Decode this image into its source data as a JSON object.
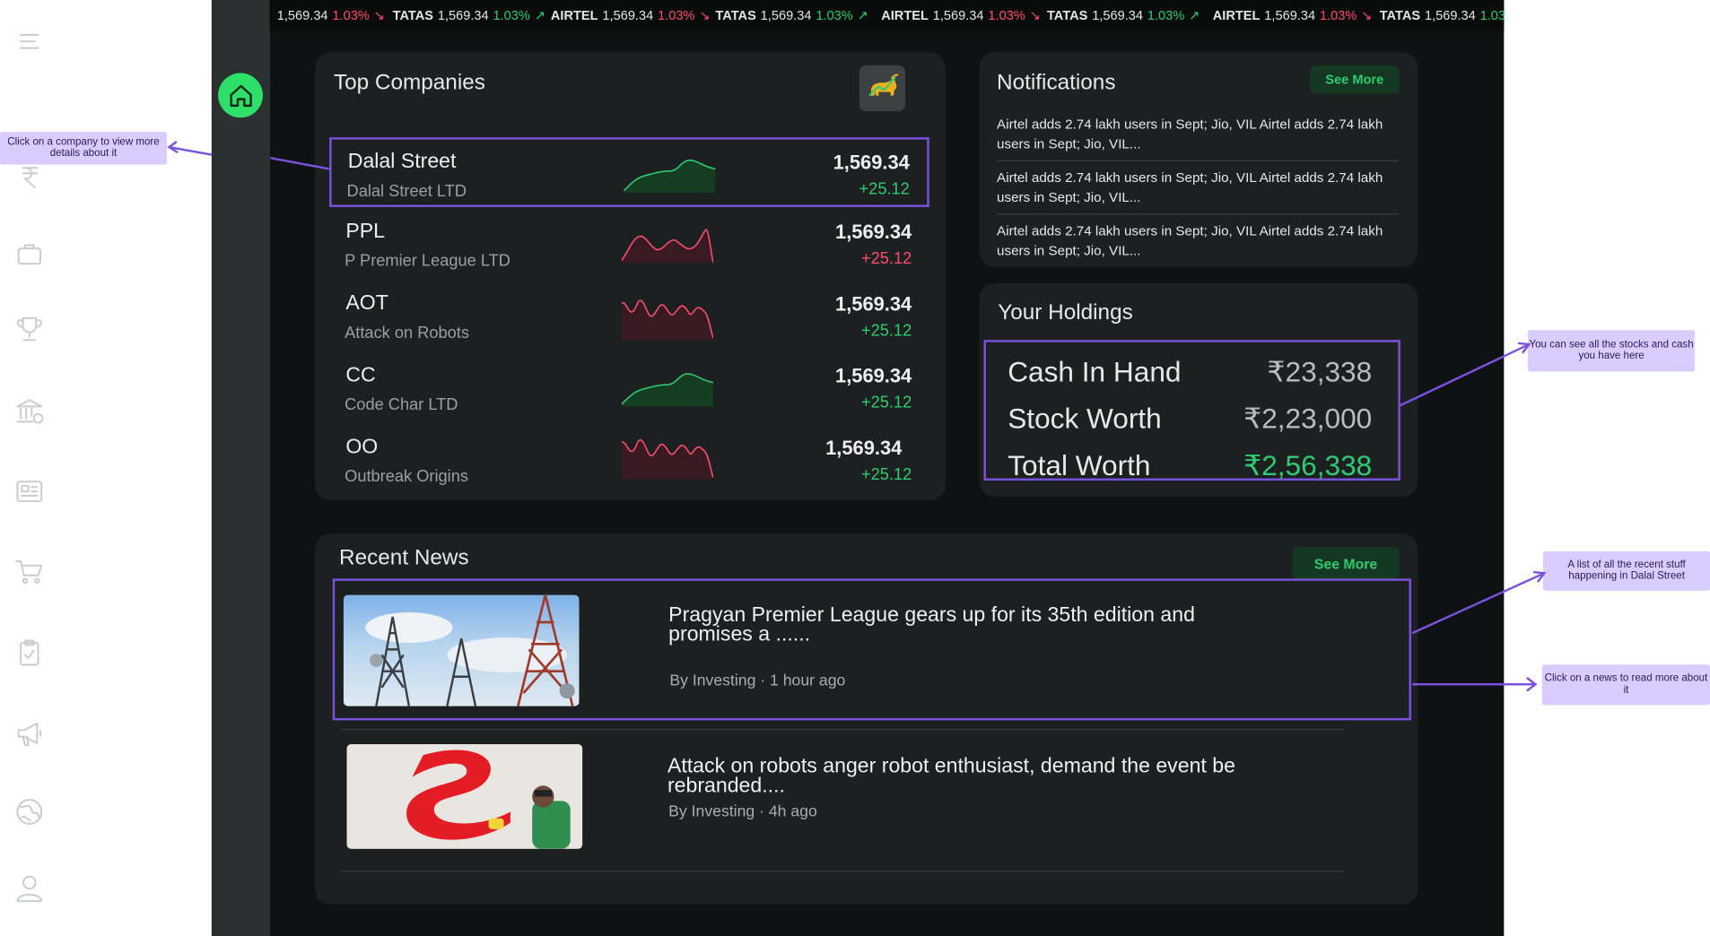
{
  "ticker": [
    {
      "sym": "",
      "price": "1,569.34",
      "pct": "1.03%",
      "dir": "down"
    },
    {
      "sym": "TATAS",
      "price": "1,569.34",
      "pct": "1.03%",
      "dir": "up"
    },
    {
      "sym": "AIRTEL",
      "price": "1,569.34",
      "pct": "1.03%",
      "dir": "down"
    },
    {
      "sym": "TATAS",
      "price": "1,569.34",
      "pct": "1.03%",
      "dir": "up"
    },
    {
      "sym": "AIRTEL",
      "price": "1,569.34",
      "pct": "1.03%",
      "dir": "down"
    },
    {
      "sym": "TATAS",
      "price": "1,569.34",
      "pct": "1.03%",
      "dir": "up"
    },
    {
      "sym": "AIRTEL",
      "price": "1,569.34",
      "pct": "1.03%",
      "dir": "down"
    },
    {
      "sym": "TATAS",
      "price": "1,569.34",
      "pct": "1.03",
      "dir": "up"
    }
  ],
  "sidebar": {
    "icons": [
      "menu-icon",
      "home-icon",
      "rupee-icon",
      "briefcase-icon",
      "trophy-icon",
      "bank-icon",
      "newspaper-icon",
      "cart-icon",
      "clipboard-check-icon",
      "megaphone-icon",
      "globe-icon",
      "user-icon"
    ],
    "active": "home-icon",
    "active_color": "#2ee06a"
  },
  "top_companies": {
    "title": "Top Companies",
    "items": [
      {
        "name": "Dalal Street",
        "full": "Dalal Street LTD",
        "price": "1,569.34",
        "change": "+25.12",
        "trend": "up"
      },
      {
        "name": "PPL",
        "full": "P Premier League LTD",
        "price": "1,569.34",
        "change": "+25.12",
        "trend": "down"
      },
      {
        "name": "AOT",
        "full": "Attack on Robots",
        "price": "1,569.34",
        "change": "+25.12",
        "trend": "down"
      },
      {
        "name": "CC",
        "full": "Code Char LTD",
        "price": "1,569.34",
        "change": "+25.12",
        "trend": "up"
      },
      {
        "name": "OO",
        "full": "Outbreak Origins",
        "price": "1,569.34",
        "change": "+25.12",
        "trend": "down"
      }
    ]
  },
  "notifications": {
    "title": "Notifications",
    "see_more": "See More",
    "items": [
      "Airtel adds 2.74 lakh users in Sept; Jio, VIL Airtel adds 2.74 lakh users in Sept; Jio, VIL...",
      "Airtel adds 2.74 lakh users in Sept; Jio, VIL Airtel adds 2.74 lakh users in Sept; Jio, VIL...",
      "Airtel adds 2.74 lakh users in Sept; Jio, VIL Airtel adds 2.74 lakh users in Sept; Jio, VIL..."
    ]
  },
  "holdings": {
    "title": "Your Holdings",
    "rows": [
      {
        "label": "Cash In Hand",
        "value": "₹23,338"
      },
      {
        "label": "Stock Worth",
        "value": "₹2,23,000"
      },
      {
        "label": "Total Worth",
        "value": "₹2,56,338"
      }
    ]
  },
  "news": {
    "title": "Recent News",
    "see_more": "See More",
    "items": [
      {
        "title": "Pragyan Premier League gears up for its 35th edition and promises a ......",
        "meta": "By Investing · 1 hour ago"
      },
      {
        "title": "Attack on robots anger robot enthusiast, demand the event be rebranded....",
        "meta": "By Investing · 4h ago"
      }
    ]
  },
  "callouts": {
    "company": "Click on a company to view more details about it",
    "holdings": "You can see all the stocks and cash you have here",
    "news_list": "A list of all the recent stuff happening in Dalal Street",
    "news_click": "Click on a news to read more about it"
  },
  "colors": {
    "up": "#2ecc71",
    "down": "#ff4d6d",
    "accent": "#7b52e0",
    "callout": "#d9ccff"
  }
}
